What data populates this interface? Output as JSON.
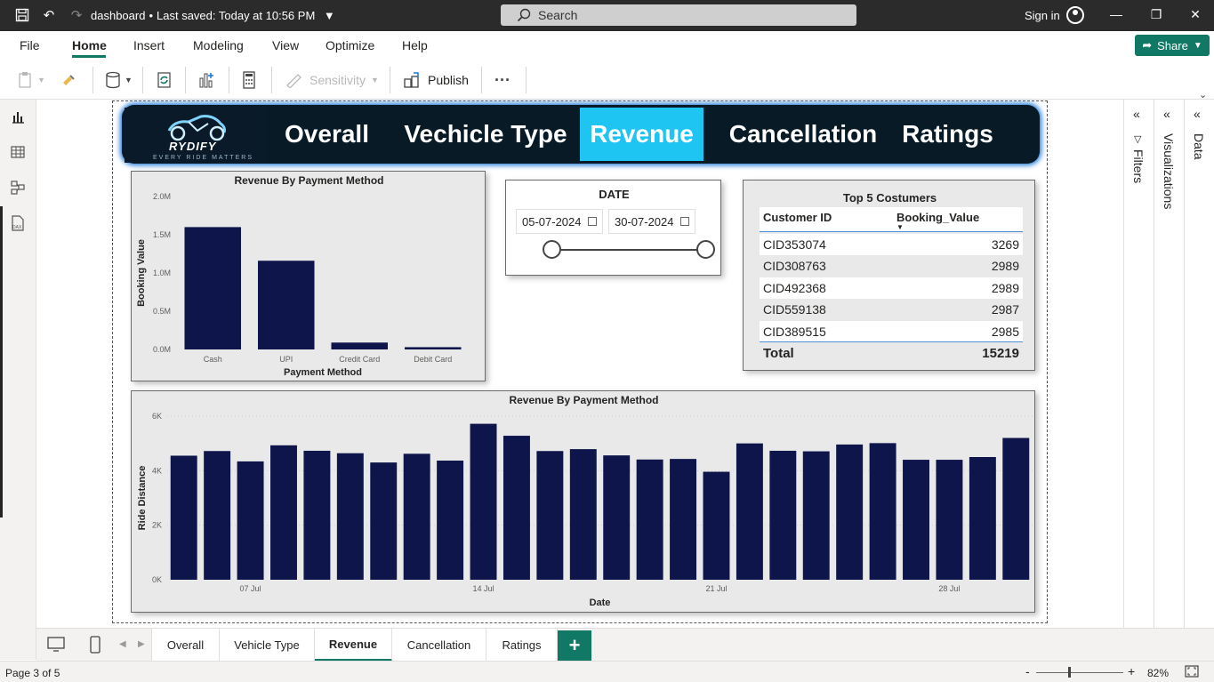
{
  "titlebar": {
    "doc_name": "dashboard",
    "saved_status": "Last saved: Today at 10:56 PM",
    "search_placeholder": "Search",
    "signin_label": "Sign in"
  },
  "menu": {
    "items": [
      "File",
      "Home",
      "Insert",
      "Modeling",
      "View",
      "Optimize",
      "Help"
    ],
    "active": "Home",
    "share_label": "Share"
  },
  "ribbon": {
    "sensitivity_label": "Sensitivity",
    "publish_label": "Publish",
    "more_label": "···"
  },
  "nav": {
    "logo_text": "RYDIFY",
    "logo_tagline": "EVERY RIDE MATTERS",
    "tabs": [
      "Overall",
      "Vechicle Type",
      "Revenue",
      "Cancellation",
      "Ratings"
    ],
    "active_tab": "Revenue",
    "active_color": "#1ec5f2"
  },
  "slicer": {
    "title": "DATE",
    "start": "05-07-2024",
    "end": "30-07-2024"
  },
  "table": {
    "title": "Top 5 Costumers",
    "headers": [
      "Customer ID",
      "Booking_Value"
    ],
    "rows": [
      [
        "CID353074",
        "3269"
      ],
      [
        "CID308763",
        "2989"
      ],
      [
        "CID492368",
        "2989"
      ],
      [
        "CID559138",
        "2987"
      ],
      [
        "CID389515",
        "2985"
      ]
    ],
    "total_label": "Total",
    "total_value": "15219"
  },
  "chart_data": [
    {
      "type": "bar",
      "title": "Revenue By Payment Method",
      "xlabel": "Payment Method",
      "ylabel": "Booking Value",
      "categories": [
        "Cash",
        "UPI",
        "Credit Card",
        "Debit Card"
      ],
      "values": [
        1600000,
        1160000,
        90000,
        30000
      ],
      "yticks": [
        "0.0M",
        "0.5M",
        "1.0M",
        "1.5M",
        "2.0M"
      ],
      "ylim": [
        0,
        2000000
      ],
      "color": "#0d154a"
    },
    {
      "type": "bar",
      "title": "Revenue By Payment Method",
      "xlabel": "Date",
      "ylabel": "Ride Distance",
      "x": [
        "05 Jul",
        "06 Jul",
        "07 Jul",
        "08 Jul",
        "09 Jul",
        "10 Jul",
        "11 Jul",
        "12 Jul",
        "13 Jul",
        "14 Jul",
        "15 Jul",
        "16 Jul",
        "17 Jul",
        "18 Jul",
        "19 Jul",
        "20 Jul",
        "21 Jul",
        "22 Jul",
        "23 Jul",
        "24 Jul",
        "25 Jul",
        "26 Jul",
        "27 Jul",
        "28 Jul",
        "29 Jul",
        "30 Jul"
      ],
      "values": [
        4550,
        4720,
        4340,
        4930,
        4730,
        4640,
        4300,
        4620,
        4370,
        5720,
        5280,
        4720,
        4790,
        4560,
        4410,
        4430,
        3960,
        5000,
        4730,
        4710,
        4960,
        5010,
        4400,
        4400,
        4500,
        5200
      ],
      "xticks": [
        "07 Jul",
        "14 Jul",
        "21 Jul",
        "28 Jul"
      ],
      "yticks": [
        "0K",
        "2K",
        "4K",
        "6K"
      ],
      "ylim": [
        0,
        6000
      ],
      "color": "#0d154a"
    }
  ],
  "pagetabs": {
    "tabs": [
      "Overall",
      "Vehicle Type",
      "Revenue",
      "Cancellation",
      "Ratings"
    ],
    "active": "Revenue",
    "add_label": "+"
  },
  "panes": {
    "filters_label": "Filters",
    "visualizations_label": "Visualizations",
    "data_label": "Data"
  },
  "status": {
    "page_label": "Page 3 of 5",
    "zoom_label": "82%"
  }
}
